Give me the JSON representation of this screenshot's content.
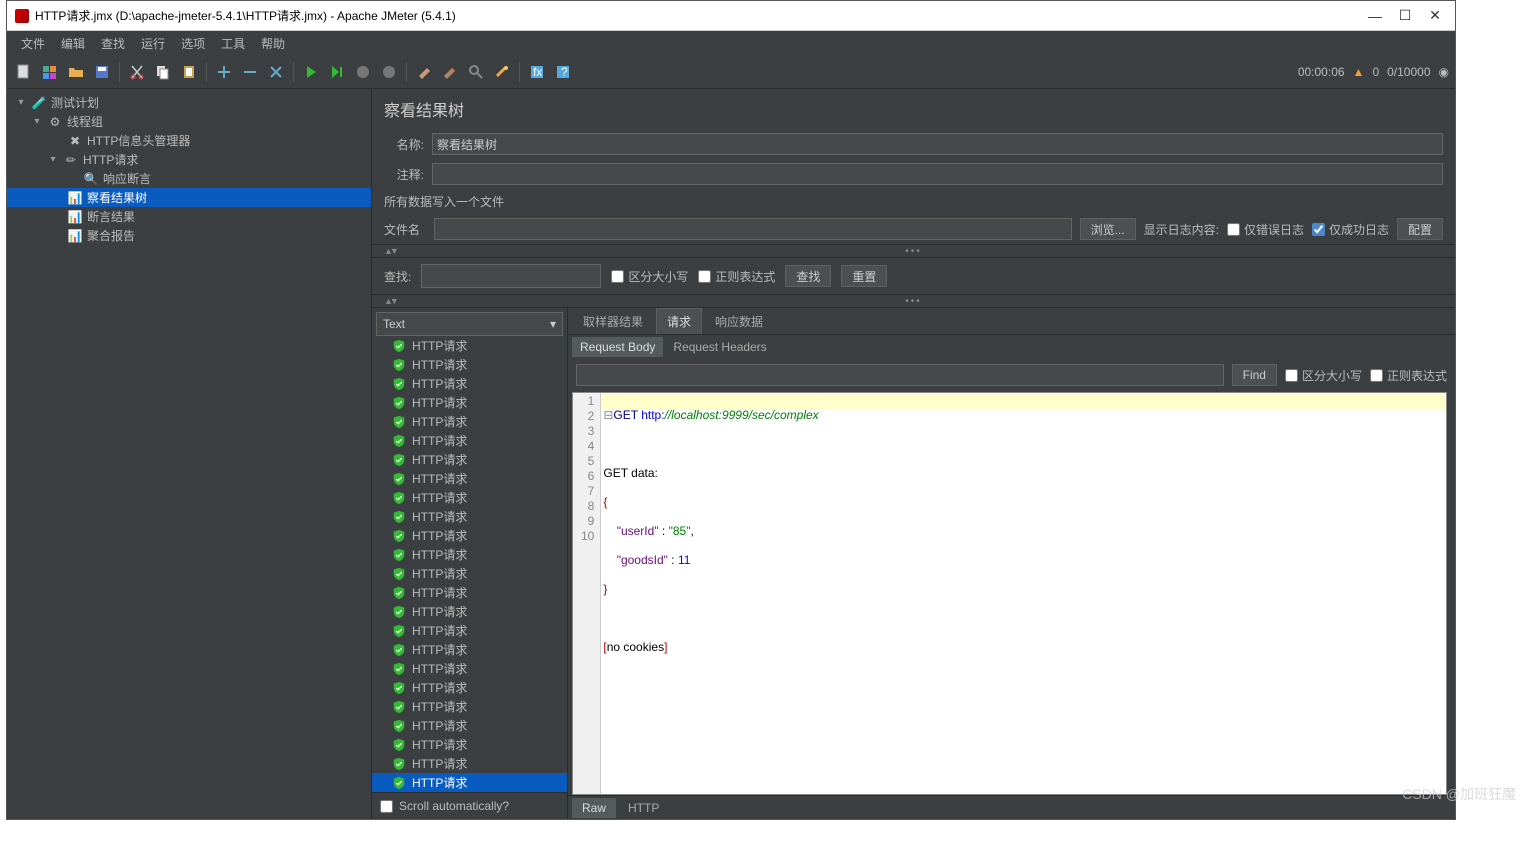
{
  "title": "HTTP请求.jmx (D:\\apache-jmeter-5.4.1\\HTTP请求.jmx) - Apache JMeter (5.4.1)",
  "menu": [
    "文件",
    "编辑",
    "查找",
    "运行",
    "选项",
    "工具",
    "帮助"
  ],
  "status": {
    "time": "00:00:06",
    "errors": "0",
    "ratio": "0/10000"
  },
  "tree": {
    "root": "测试计划",
    "group": "线程组",
    "header_mgr": "HTTP信息头管理器",
    "http_req": "HTTP请求",
    "resp_assert": "响应断言",
    "view_results": "察看结果树",
    "assert_results": "断言结果",
    "aggregate": "聚合报告"
  },
  "panel": {
    "title": "察看结果树",
    "name_label": "名称:",
    "name_value": "察看结果树",
    "comment_label": "注释:",
    "file_section": "所有数据写入一个文件",
    "file_label": "文件名",
    "browse": "浏览...",
    "log_show": "显示日志内容:",
    "only_errors": "仅错误日志",
    "only_success": "仅成功日志",
    "configure": "配置"
  },
  "search": {
    "label": "查找:",
    "case": "区分大小写",
    "regex": "正则表达式",
    "find": "查找",
    "reset": "重置"
  },
  "results": {
    "renderer": "Text",
    "item": "HTTP请求",
    "count": 25,
    "selected_index": 24,
    "scroll_auto": "Scroll automatically?"
  },
  "tabs": {
    "sampler": "取样器结果",
    "request": "请求",
    "response": "响应数据"
  },
  "subtabs": {
    "body": "Request Body",
    "headers": "Request Headers"
  },
  "find": {
    "btn": "Find",
    "case": "区分大小写",
    "regex": "正则表达式"
  },
  "code": {
    "method": "GET",
    "proto": "http:",
    "url": "//localhost:9999/sec/complex",
    "data_label": "GET data",
    "k1": "\"userId\"",
    "v1": "\"85\"",
    "k2": "\"goodsId\"",
    "v2": "11",
    "nocookies": "no cookies"
  },
  "bottom": {
    "raw": "Raw",
    "http": "HTTP"
  },
  "watermark": "CSDN @加班狂魔"
}
